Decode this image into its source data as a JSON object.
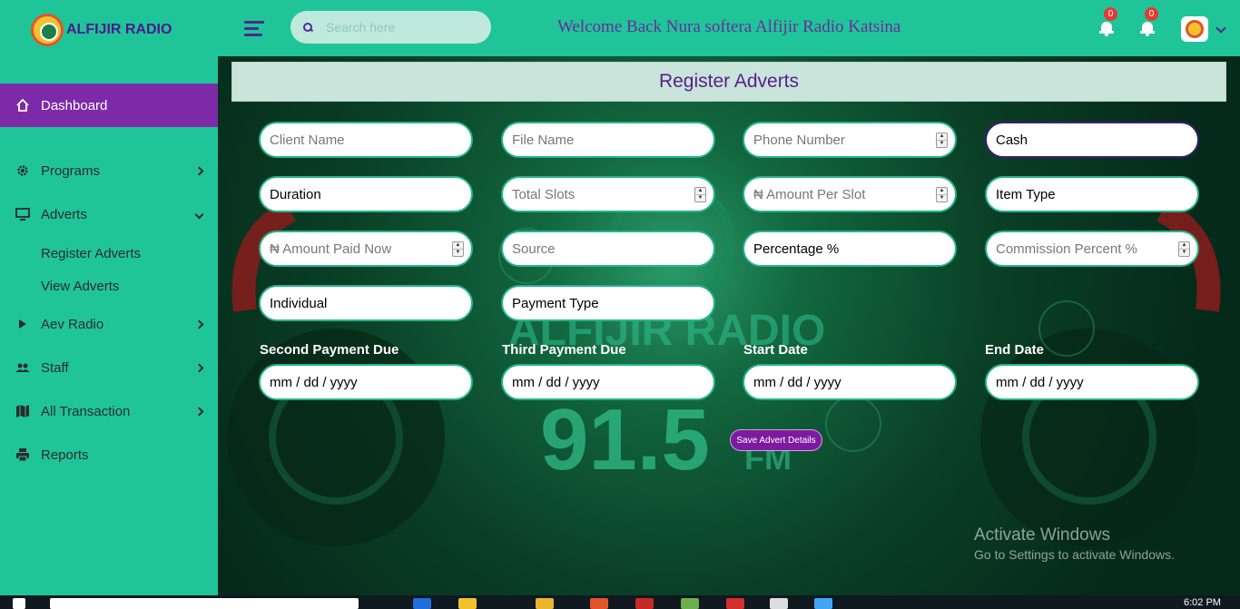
{
  "brand": {
    "name": "ALFIJIR RADIO"
  },
  "header": {
    "search_placeholder": "Search here",
    "welcome": "Welcome Back Nura softera Alfijir Radio Katsina",
    "notifications": [
      {
        "count": "0"
      },
      {
        "count": "0"
      }
    ]
  },
  "sidebar": {
    "items": [
      {
        "label": "Dashboard",
        "icon": "home-icon"
      },
      {
        "label": "Programs",
        "icon": "gear-icon"
      },
      {
        "label": "Adverts",
        "icon": "monitor-icon"
      },
      {
        "label": "Aev Radio",
        "icon": "play-icon"
      },
      {
        "label": "Staff",
        "icon": "users-icon"
      },
      {
        "label": "All Transaction",
        "icon": "map-icon"
      },
      {
        "label": "Reports",
        "icon": "print-icon"
      }
    ],
    "adverts_sub": [
      "Register Adverts",
      "View Adverts"
    ]
  },
  "form": {
    "title": "Register Adverts",
    "client_name_placeholder": "Client Name",
    "file_name_placeholder": "File Name",
    "phone_placeholder": "Phone Number",
    "payment_mode_value": "Cash",
    "duration_value": "Duration",
    "total_slots_placeholder": "Total Slots",
    "amount_per_slot_placeholder": "₦ Amount Per Slot",
    "item_type_value": "Item Type",
    "amount_paid_placeholder": "₦ Amount Paid Now",
    "source_placeholder": "Source",
    "percentage_value": "Percentage %",
    "commission_placeholder": "Commission Percent %",
    "individual_value": "Individual",
    "payment_type_value": "Payment Type",
    "second_payment_due_label": "Second Payment Due",
    "third_payment_due_label": "Third Payment Due",
    "start_date_label": "Start Date",
    "end_date_label": "End Date",
    "date_placeholder": "mm / dd / yyyy",
    "save_label": "Save Advert Details"
  },
  "watermark": {
    "line1": "Activate Windows",
    "line2": "Go to Settings to activate Windows."
  },
  "taskbar": {
    "time": "6:02 PM"
  },
  "colors": {
    "accent": "#1fc599",
    "active": "#7d2aa8",
    "brand_text": "#4b1a8c"
  }
}
